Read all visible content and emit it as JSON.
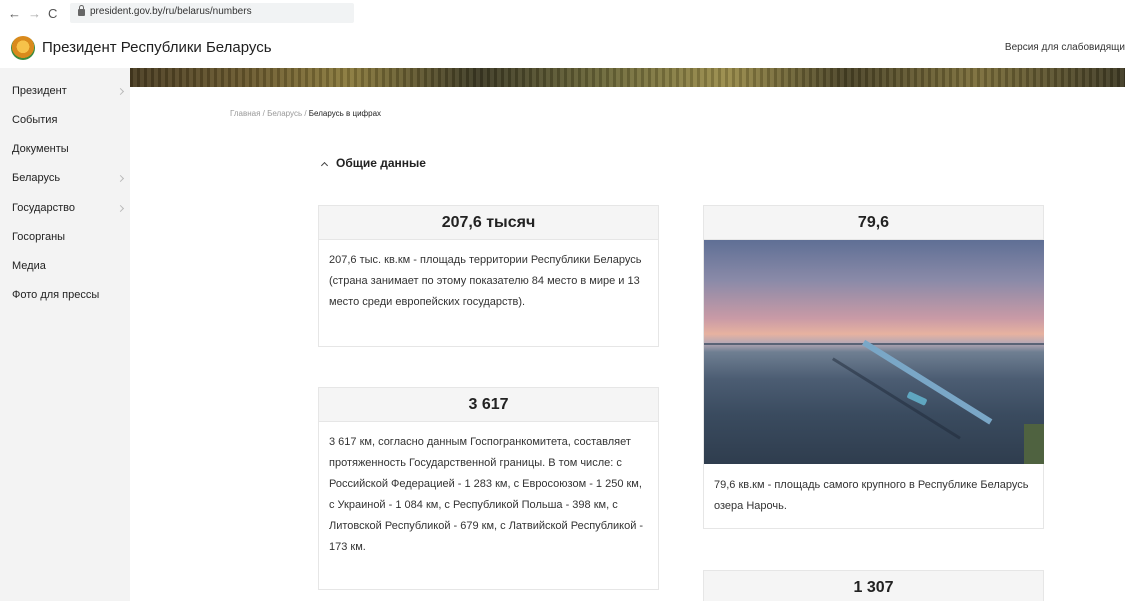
{
  "browser": {
    "url": "president.gov.by/ru/belarus/numbers",
    "back_glyph": "←",
    "forward_glyph": "→",
    "reload_glyph": "C"
  },
  "header": {
    "site_title": "Президент Республики Беларусь",
    "low_vision_link": "Версия для слабовидящи"
  },
  "sidebar": {
    "items": [
      {
        "label": "Президент",
        "has_submenu": true
      },
      {
        "label": "События",
        "has_submenu": false
      },
      {
        "label": "Документы",
        "has_submenu": false
      },
      {
        "label": "Беларусь",
        "has_submenu": true
      },
      {
        "label": "Государство",
        "has_submenu": true
      },
      {
        "label": "Госорганы",
        "has_submenu": false
      },
      {
        "label": "Медиа",
        "has_submenu": false
      },
      {
        "label": "Фото для прессы",
        "has_submenu": false
      }
    ]
  },
  "breadcrumb": {
    "home": "Главная",
    "sep": " / ",
    "parent": "Беларусь",
    "current": "Беларусь в цифрах"
  },
  "section": {
    "title": "Общие данные"
  },
  "cards": {
    "area": {
      "title": "207,6 тысяч",
      "text": "207,6 тыс. кв.км - площадь территории Республики Беларусь (страна занимает по этому показателю 84 место в мире и 13 место среди европейских государств)."
    },
    "lake": {
      "title": "79,6",
      "text": "79,6 кв.км - площадь самого крупного в Республике Беларусь озера Нарочь."
    },
    "border": {
      "title": "3 617",
      "text": "3 617 км, согласно данным Госпогранкомитета, составляет протяженность Государственной границы. В том числе: с Российской Федерацией - 1 283 км, с Евросоюзом - 1 250 км, с Украиной - 1 084 км, с Республикой Польша - 398 км, с Литовской Республикой - 679 км, с Латвийской Республикой - 173 км."
    },
    "next": {
      "title": "1 307"
    }
  },
  "colors": {
    "sidebar_bg": "#f3f3f3",
    "card_header_bg": "#f5f5f5",
    "card_border": "#e6e6e6"
  }
}
